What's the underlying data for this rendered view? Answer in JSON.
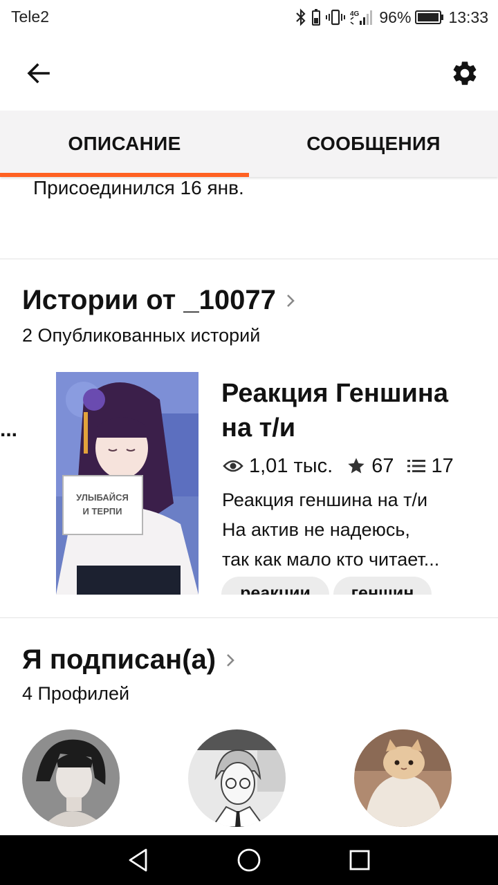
{
  "status_bar": {
    "carrier": "Tele2",
    "network": "4G",
    "battery": "96%",
    "time": "13:33"
  },
  "tabs": [
    {
      "label": "ОПИСАНИЕ",
      "active": true
    },
    {
      "label": "СООБЩЕНИЯ",
      "active": false
    }
  ],
  "accent_color": "#ff6122",
  "profile": {
    "joined": "Присоединился 16 янв."
  },
  "stories_section": {
    "title": "Истории от _10077",
    "subtitle": "2 Опубликованных историй",
    "prev_card_fragment": "...",
    "story": {
      "cover_text_line1": "УЛЫБАЙСЯ",
      "cover_text_line2": "И ТЕРПИ",
      "title_line1": "Реакция Геншина",
      "title_line2": "на т/и",
      "reads": "1,01 тыс.",
      "votes": "67",
      "parts": "17",
      "description_lines": [
        "Реакция геншина на т/и",
        "На актив не надеюсь,",
        "так как мало кто читает..."
      ],
      "tags": [
        "реакции",
        "геншин"
      ]
    }
  },
  "following_section": {
    "title": "Я подписан(а)",
    "subtitle": "4 Профилей",
    "avatars": [
      "avatar-dark-hair",
      "avatar-manga-glasses",
      "avatar-cat-blanket"
    ]
  },
  "icons": {
    "back": "arrow-left-icon",
    "settings": "gear-icon",
    "reads": "eye-icon",
    "votes": "star-icon",
    "parts": "list-icon"
  }
}
